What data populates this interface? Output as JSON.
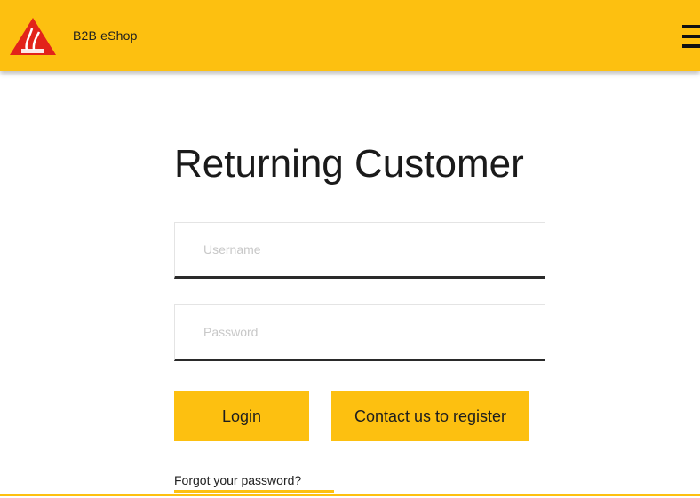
{
  "header": {
    "brand": "B2B eShop",
    "logo_icon": "sika-logo-icon",
    "menu_icon": "hamburger-menu-icon",
    "background_color": "#FDC010"
  },
  "login": {
    "title": "Returning Customer",
    "username_placeholder": "Username",
    "password_placeholder": "Password",
    "login_button": "Login",
    "register_button": "Contact us to register",
    "forgot_link": "Forgot your password?"
  },
  "colors": {
    "accent": "#FDC010",
    "logo_red": "#E2231A"
  }
}
